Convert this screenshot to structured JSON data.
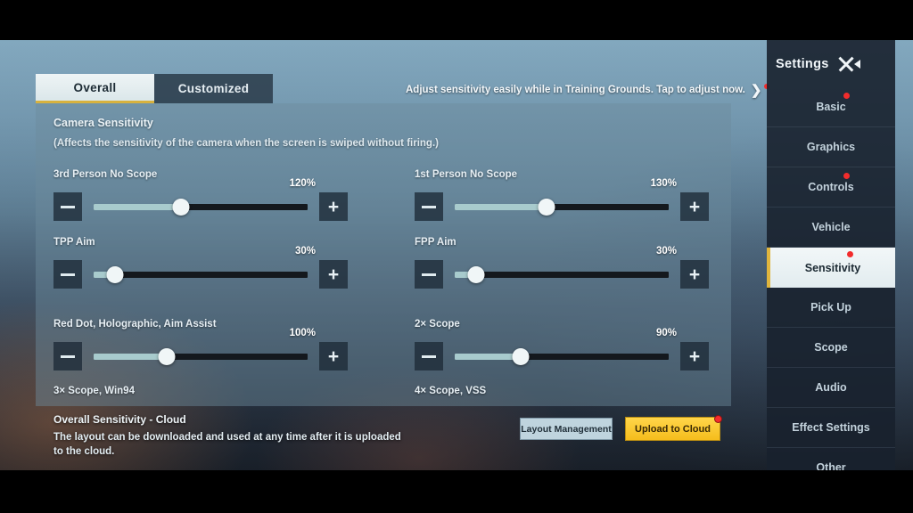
{
  "tabs": [
    {
      "label": "Overall",
      "active": true
    },
    {
      "label": "Customized",
      "active": false
    }
  ],
  "banner": {
    "text": "Adjust sensitivity easily while in Training Grounds. Tap to adjust now.",
    "chevron": "chevron-right-icon",
    "has_notification_dot": true
  },
  "camera_section": {
    "title": "Camera Sensitivity",
    "subtitle": "(Affects the sensitivity of the camera when the screen is swiped without firing.)"
  },
  "sliders": [
    {
      "label": "3rd Person No Scope",
      "value": "120%",
      "fill_percent": 41,
      "minus": "minus-icon",
      "plus": "plus-icon"
    },
    {
      "label": "1st Person No Scope",
      "value": "130%",
      "fill_percent": 43,
      "minus": "minus-icon",
      "plus": "plus-icon"
    },
    {
      "label": "TPP Aim",
      "value": "30%",
      "fill_percent": 10,
      "minus": "minus-icon",
      "plus": "plus-icon"
    },
    {
      "label": "FPP Aim",
      "value": "30%",
      "fill_percent": 10,
      "minus": "minus-icon",
      "plus": "plus-icon"
    },
    {
      "label": "Red Dot, Holographic, Aim Assist",
      "value": "100%",
      "fill_percent": 34,
      "minus": "minus-icon",
      "plus": "plus-icon"
    },
    {
      "label": "2× Scope",
      "value": "90%",
      "fill_percent": 31,
      "minus": "minus-icon",
      "plus": "plus-icon"
    }
  ],
  "sublabels": {
    "left": "3× Scope, Win94",
    "right": "4× Scope, VSS"
  },
  "cloud": {
    "title": "Overall Sensitivity - Cloud",
    "description": "The layout can be downloaded and used at any time after it is uploaded to the cloud."
  },
  "buttons": {
    "layout_management": "Layout Management",
    "upload_to_cloud": "Upload to Cloud"
  },
  "sidebar": {
    "title": "Settings",
    "close_icon": "close-x-icon",
    "collapse_icon": "triangle-left-icon",
    "items": [
      {
        "label": "Basic",
        "active": false,
        "dot": true
      },
      {
        "label": "Graphics",
        "active": false,
        "dot": false
      },
      {
        "label": "Controls",
        "active": false,
        "dot": true
      },
      {
        "label": "Vehicle",
        "active": false,
        "dot": false
      },
      {
        "label": "Sensitivity",
        "active": true,
        "dot": true
      },
      {
        "label": "Pick Up",
        "active": false,
        "dot": false
      },
      {
        "label": "Scope",
        "active": false,
        "dot": false
      },
      {
        "label": "Audio",
        "active": false,
        "dot": false
      },
      {
        "label": "Effect Settings",
        "active": false,
        "dot": false
      },
      {
        "label": "Other",
        "active": false,
        "dot": false
      }
    ]
  },
  "colors": {
    "accent_yellow": "#f5bd1c",
    "notification_red": "#f22c2c",
    "slider_fill": "#a8cbcd",
    "slider_track": "#14181d",
    "panel_overlay": "rgba(108,140,156,0.46)",
    "sidebar_bg": "rgba(24,33,45,0.90)"
  }
}
